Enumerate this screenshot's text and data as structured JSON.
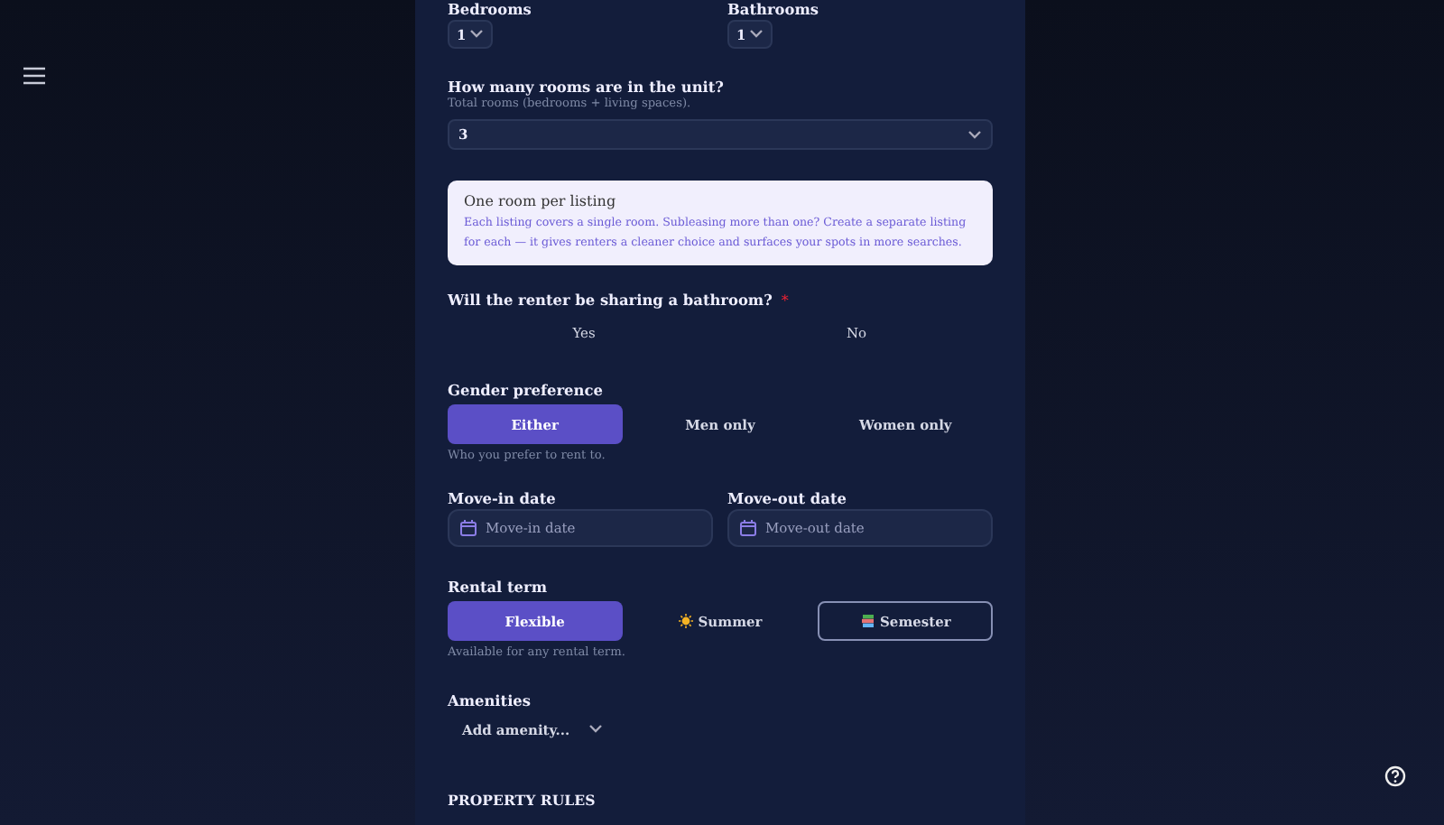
{
  "counts": [
    {
      "label": "Bedrooms",
      "value": "1"
    },
    {
      "label": "Bathrooms",
      "value": "1"
    }
  ],
  "rooms": {
    "label": "How many rooms are in the unit?",
    "hint": "Total rooms (bedrooms + living spaces).",
    "value": "3"
  },
  "notice": {
    "title": "One room per listing",
    "body": "Each listing covers a single room. Subleasing more than one? Create a separate listing for each — it gives renters a cleaner choice and surfaces your spots in more searches."
  },
  "bathroom": {
    "label": "Will the renter be sharing a bathroom?",
    "required_mark": "*",
    "options": [
      {
        "label": "Yes",
        "selected": false
      },
      {
        "label": "No",
        "selected": false
      }
    ]
  },
  "gender": {
    "label": "Gender preference",
    "options": [
      {
        "label": "Either",
        "selected": true
      },
      {
        "label": "Men only",
        "selected": false
      },
      {
        "label": "Women only",
        "selected": false
      }
    ],
    "hint": "Who you prefer to rent to."
  },
  "dates": [
    {
      "label": "Move-in date",
      "placeholder": "Move-in date"
    },
    {
      "label": "Move-out date",
      "placeholder": "Move-out date"
    }
  ],
  "rental_term": {
    "label": "Rental term",
    "options": [
      {
        "label": "Flexible",
        "selected": true,
        "focused": false,
        "kind": "plain"
      },
      {
        "label": "Summer",
        "selected": false,
        "focused": false,
        "kind": "sun"
      },
      {
        "label": "Semester",
        "selected": false,
        "focused": true,
        "kind": "books"
      }
    ],
    "hint": "Available for any rental term."
  },
  "amenities": {
    "label": "Amenities",
    "placeholder": "Add amenity..."
  },
  "section_heading": "PROPERTY RULES"
}
